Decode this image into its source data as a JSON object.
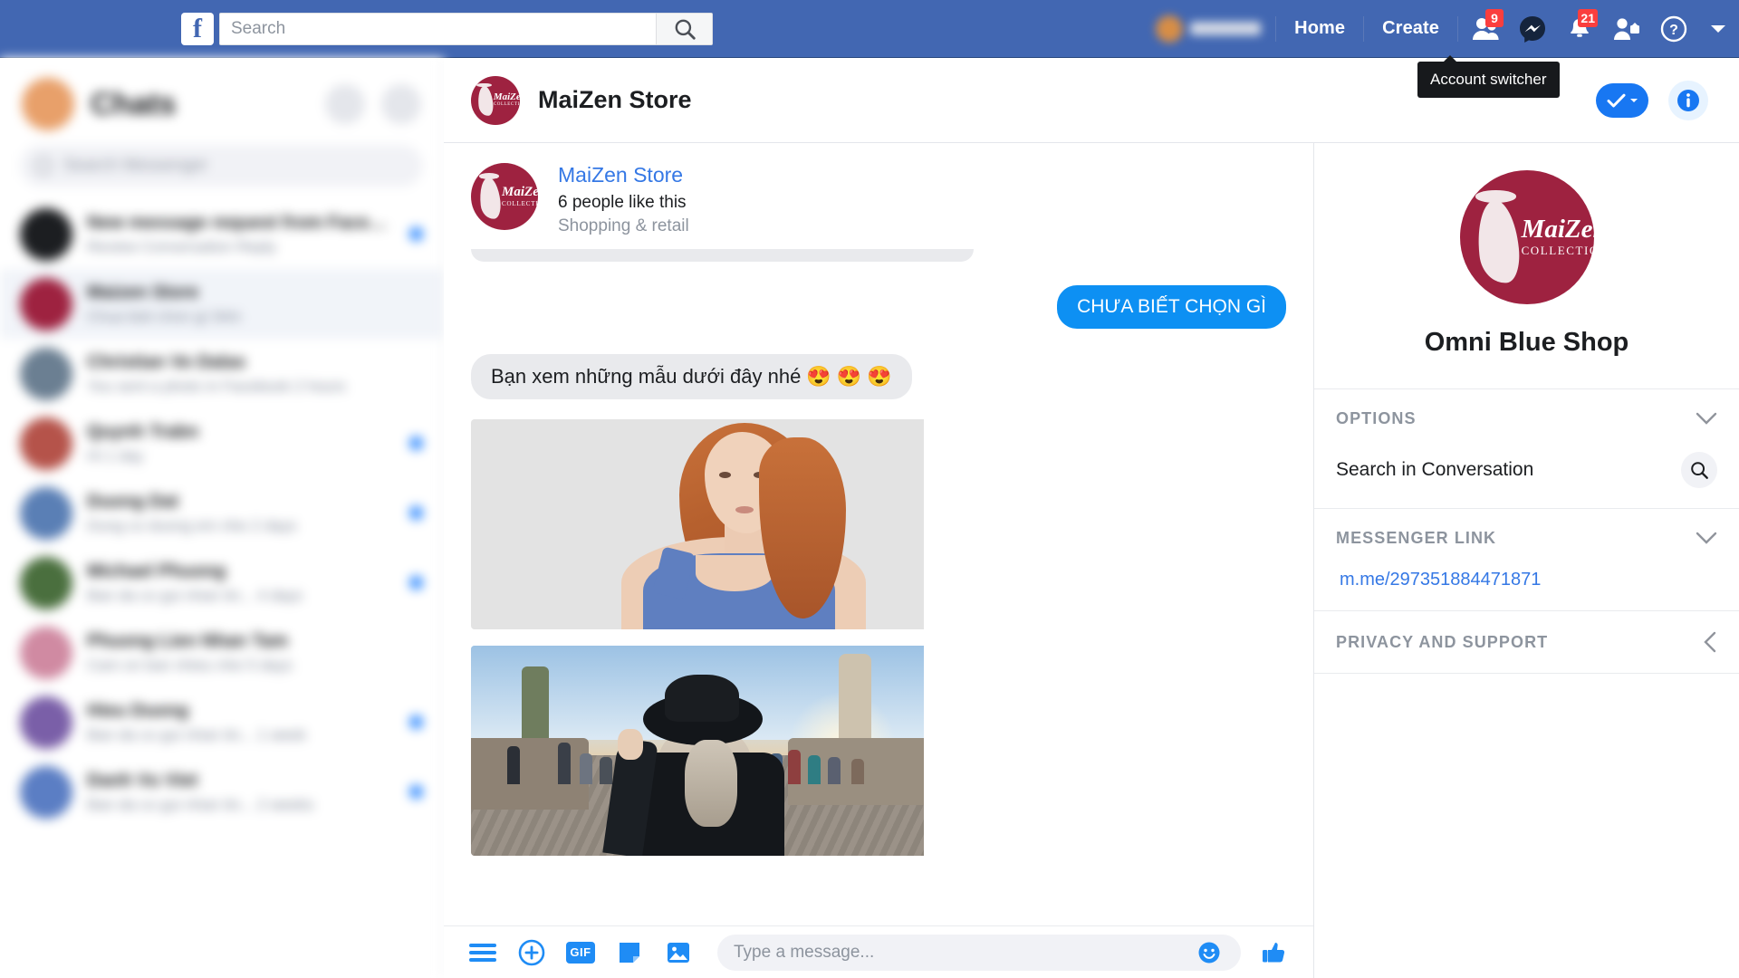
{
  "topbar": {
    "logo_letter": "f",
    "search": {
      "placeholder": "Search",
      "value": ""
    },
    "search_icon": "search-icon",
    "nav": [
      {
        "label": "Home",
        "name": "home"
      },
      {
        "label": "Create",
        "name": "create"
      }
    ],
    "friend_requests_badge": "9",
    "notifications_badge": "21",
    "tooltip": "Account switcher"
  },
  "left_sidebar": {
    "title": "Chats",
    "search_placeholder": "Search Messenger",
    "rows": [
      {
        "name": "New message request from Facebook user",
        "snippet": "Review Conversation  Reply",
        "unread": true,
        "avatar": "#1c1e21",
        "selected": false
      },
      {
        "name": "Maizen Store",
        "snippet": "Chua biet chon gi  34m",
        "unread": false,
        "avatar": "#9e2240",
        "selected": true
      },
      {
        "name": "Christian Vo Dalas",
        "snippet": "You sent a photo in Facebook  2 hours",
        "unread": false,
        "avatar": "#6b7f92",
        "selected": false
      },
      {
        "name": "Quynh Trabn",
        "snippet": "Hi  1 day",
        "unread": true,
        "avatar": "#b5534a",
        "selected": false
      },
      {
        "name": "Duong Dat",
        "snippet": "Dung co duong em nhe  2 days",
        "unread": true,
        "avatar": "#5a7fb5",
        "selected": false
      },
      {
        "name": "Michael Phuong",
        "snippet": "Ban da co gui nhan tin...  4 days",
        "unread": true,
        "avatar": "#4a6f3e",
        "selected": false
      },
      {
        "name": "Phuong Lien Nhan Tam",
        "snippet": "Cam on ban nhieu nhe  5 days",
        "unread": false,
        "avatar": "#d08aa2",
        "selected": false
      },
      {
        "name": "Hieu Duong",
        "snippet": "Ban da co gui nhan tin...  1 week",
        "unread": true,
        "avatar": "#7a5fa8",
        "selected": false
      },
      {
        "name": "Danh Vu Viet",
        "snippet": "Ban da co gui nhan tin...  2 weeks",
        "unread": true,
        "avatar": "#5b7ec4",
        "selected": false
      }
    ]
  },
  "conversation": {
    "header_title": "MaiZen Store",
    "page_card": {
      "name": "MaiZen Store",
      "likes": "6 people like this",
      "category": "Shopping & retail"
    },
    "messages": [
      {
        "type": "outgoing",
        "text": "CHƯA BIẾT CHỌN GÌ"
      },
      {
        "type": "incoming",
        "text": "Bạn xem những mẫu dưới đây nhé 😍 😍 😍"
      },
      {
        "type": "attachment",
        "alt": "Model wearing blue tank top on grey background"
      },
      {
        "type": "attachment",
        "alt": "Woman in black hat and coat on a European bridge"
      }
    ]
  },
  "composer": {
    "placeholder": "Type a message...",
    "gif_label": "GIF",
    "icons": [
      "menu-icon",
      "plus-icon",
      "gif-icon",
      "sticker-icon",
      "photo-icon",
      "emoji-icon",
      "thumbs-up-icon"
    ]
  },
  "logo": {
    "name": "MaiZen",
    "sub": "COLLECTION",
    "color": "#9e2240"
  },
  "right_sidebar": {
    "profile_name": "Omni Blue Shop",
    "sections": [
      {
        "label": "OPTIONS",
        "chevron": "chevron-down-icon"
      },
      {
        "label": "MESSENGER LINK",
        "chevron": "chevron-down-icon"
      },
      {
        "label": "PRIVACY AND SUPPORT",
        "chevron": "chevron-left-icon"
      }
    ],
    "search_in_conversation": "Search in Conversation",
    "messenger_link": "m.me/297351884471871"
  },
  "colors": {
    "fb_blue": "#4267b2",
    "accent_blue": "#1877f2",
    "bubble_blue": "#0d90f3",
    "bubble_grey": "#e9eaed",
    "badge_red": "#fa3e3e",
    "brand_maroon": "#9e2240"
  }
}
